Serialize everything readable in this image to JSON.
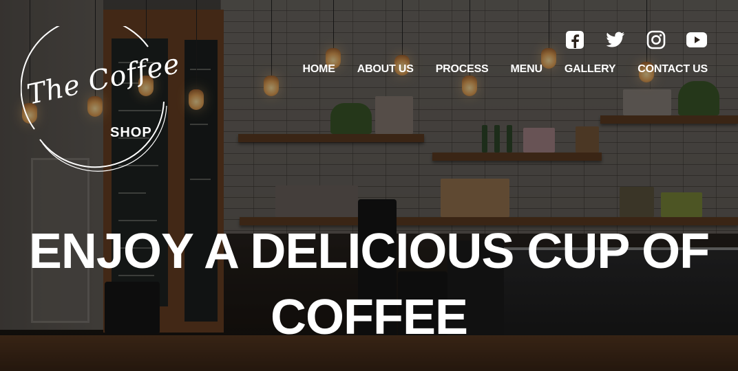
{
  "logo": {
    "script": "The Coffee",
    "sub": "SHOP"
  },
  "social": [
    {
      "icon": "facebook-icon"
    },
    {
      "icon": "twitter-icon"
    },
    {
      "icon": "instagram-icon"
    },
    {
      "icon": "youtube-icon"
    }
  ],
  "nav": {
    "items": [
      "HOME",
      "ABOUT US",
      "PROCESS",
      "MENU",
      "GALLERY",
      "CONTACT US"
    ]
  },
  "hero": {
    "line1": "ENJOY A DELICIOUS CUP OF",
    "line2": "COFFEE"
  },
  "colors": {
    "text": "#ffffff",
    "wood": "#5e3d22"
  }
}
